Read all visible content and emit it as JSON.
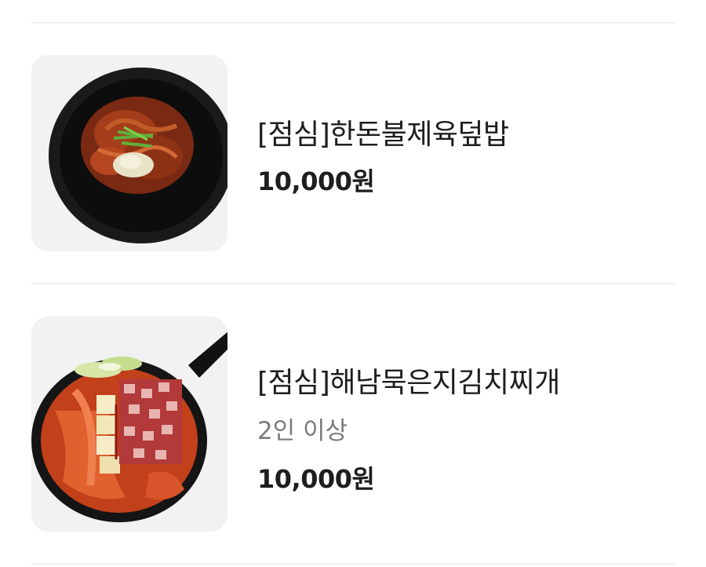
{
  "menu": {
    "items": [
      {
        "name": "[점심]한돈불제육덮밥",
        "price": "10,000원",
        "image_icon": "pork-rice-bowl-photo"
      },
      {
        "name": "[점심]해남묵은지김치찌개",
        "note": "2인 이상",
        "price": "10,000원",
        "image_icon": "kimchi-stew-pan-photo"
      }
    ]
  },
  "colors": {
    "divider": "#f0f0f0",
    "thumb_bg": "#f2f2f2",
    "text_primary": "#1e1e1e",
    "text_secondary": "#7b7b7b"
  }
}
